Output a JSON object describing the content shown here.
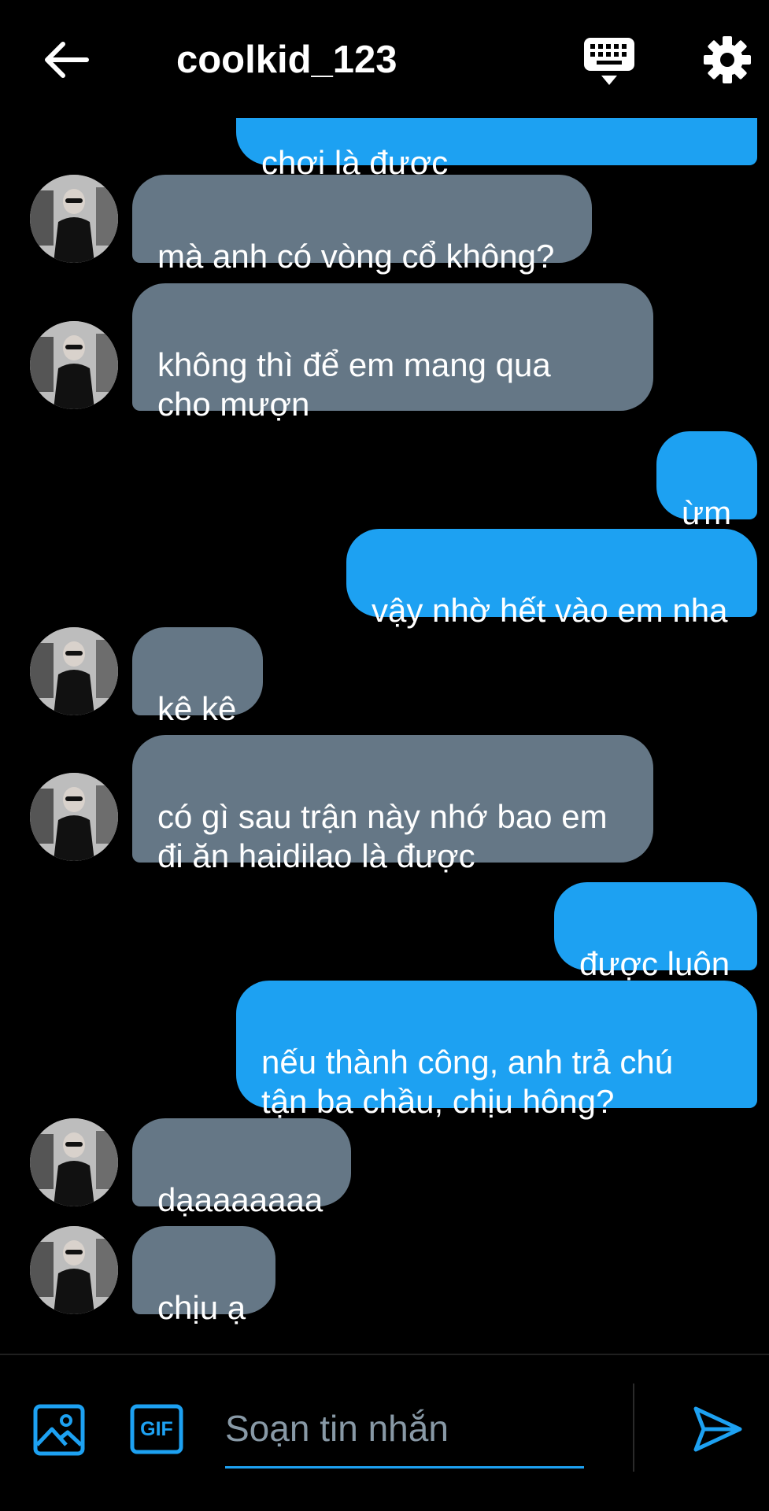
{
  "header": {
    "back_icon": "arrow-left-icon",
    "title": "coolkid_123",
    "keyboard_icon": "keyboard-icon",
    "settings_icon": "gear-icon"
  },
  "colors": {
    "incoming_bubble": "#657786",
    "outgoing_bubble": "#1da1f2",
    "background": "#000000",
    "accent": "#1da1f2",
    "placeholder": "#8899a6"
  },
  "messages": [
    {
      "dir": "out",
      "text": "chơi là được"
    },
    {
      "dir": "in",
      "text": "mà anh có vòng cổ không?"
    },
    {
      "dir": "in",
      "text": "không thì để em mang qua\ncho mượn"
    },
    {
      "dir": "out",
      "text": "ừm"
    },
    {
      "dir": "out",
      "text": "vậy nhờ hết vào em nha"
    },
    {
      "dir": "in",
      "text": "kê kê"
    },
    {
      "dir": "in",
      "text": "có gì sau trận này nhớ bao em\nđi ăn haidilao là được"
    },
    {
      "dir": "out",
      "text": "được luôn"
    },
    {
      "dir": "out",
      "text": "nếu thành công, anh trả chú\ntận ba chầu, chịu hông?"
    },
    {
      "dir": "in",
      "text": "dạaaaaaaa"
    },
    {
      "dir": "in",
      "text": "chịu ạ"
    }
  ],
  "composer": {
    "image_icon": "image-icon",
    "gif_label": "GIF",
    "placeholder": "Soạn tin nhắn",
    "value": "",
    "send_icon": "send-icon"
  }
}
